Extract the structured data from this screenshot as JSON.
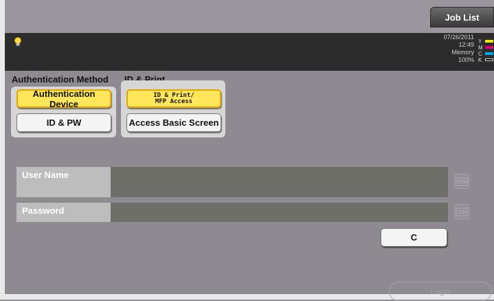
{
  "header": {
    "job_list": "Job List"
  },
  "status": {
    "date": "07/26/2011",
    "time": "12:49",
    "memory_label": "Memory",
    "memory_value": "100%",
    "toner_labels": [
      "Y",
      "M",
      "C",
      "K"
    ],
    "toner_colors": [
      "#f7e40a",
      "#e2007a",
      "#00a5e6",
      "#111111"
    ]
  },
  "auth_method": {
    "title": "Authentication Method",
    "auth_device": "Authentication Device",
    "id_pw": "ID & PW"
  },
  "id_print": {
    "title": "ID & Print",
    "mfp_line1": "ID & Print/",
    "mfp_line2": "MFP Access",
    "basic_screen": "Access Basic Screen"
  },
  "form": {
    "user_name_label": "User Name",
    "user_name_value": "",
    "password_label": "Password",
    "password_value": ""
  },
  "actions": {
    "clear": "C",
    "login": "Login"
  }
}
